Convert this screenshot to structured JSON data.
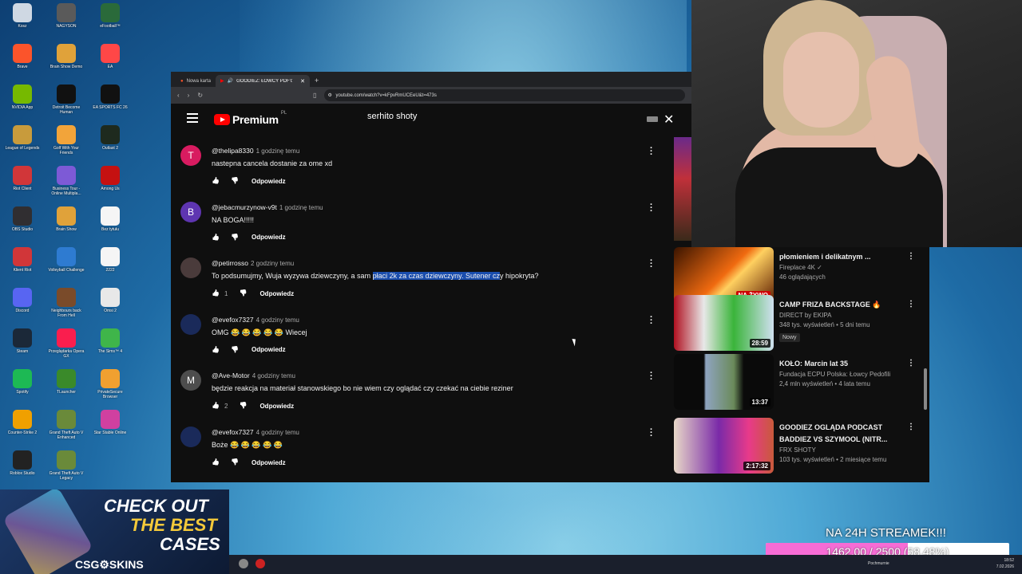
{
  "desktop_icons": [
    {
      "label": "Kosz",
      "color": "#cfd8e3"
    },
    {
      "label": "NAGYSON",
      "color": "#5a5a5a"
    },
    {
      "label": "eFootball™",
      "color": "#2a6a3a"
    },
    {
      "label": "Brave",
      "color": "#fb542b"
    },
    {
      "label": "Brain Show Demo",
      "color": "#e0a23a"
    },
    {
      "label": "EA",
      "color": "#ff4747"
    },
    {
      "label": "NVIDIA App",
      "color": "#76b900"
    },
    {
      "label": "Detroit Become Human",
      "color": "#111111"
    },
    {
      "label": "EA SPORTS FC 26",
      "color": "#111111"
    },
    {
      "label": "League of Legends",
      "color": "#c89b3c"
    },
    {
      "label": "Golf With Your Friends",
      "color": "#f2a43a"
    },
    {
      "label": "Outlast 2",
      "color": "#1e2a1e"
    },
    {
      "label": "Riot Client",
      "color": "#d13639"
    },
    {
      "label": "Business Tour - Online Multipla...",
      "color": "#7d5ad6"
    },
    {
      "label": "Among Us",
      "color": "#c51111"
    },
    {
      "label": "OBS Studio",
      "color": "#302e31"
    },
    {
      "label": "Brain Show",
      "color": "#e0a23a"
    },
    {
      "label": "Bez tytułu",
      "color": "#f5f5f5"
    },
    {
      "label": "Klient Riot",
      "color": "#d13639"
    },
    {
      "label": "Volleyball Challenge",
      "color": "#2e7bd1"
    },
    {
      "label": "2222",
      "color": "#f5f5f5"
    },
    {
      "label": "Discord",
      "color": "#5865f2"
    },
    {
      "label": "Neighbours back From Hell",
      "color": "#7a4b2a"
    },
    {
      "label": "Omsi 2",
      "color": "#e8e8e8"
    },
    {
      "label": "Steam",
      "color": "#1b2838"
    },
    {
      "label": "Przeglądarka Opera GX",
      "color": "#fa1e4e"
    },
    {
      "label": "The Sims™ 4",
      "color": "#3fb54a"
    },
    {
      "label": "Spotify",
      "color": "#1db954"
    },
    {
      "label": "TLauncher",
      "color": "#3a8a2a"
    },
    {
      "label": "PrivateSecure Browser",
      "color": "#f0a030"
    },
    {
      "label": "Counter-Strike 2",
      "color": "#f0a000"
    },
    {
      "label": "Grand Theft Auto V Enhanced",
      "color": "#6a8a3a"
    },
    {
      "label": "Star Stable Online",
      "color": "#d040a0"
    },
    {
      "label": "Roblox Studio",
      "color": "#222222"
    },
    {
      "label": "Grand Theft Auto V Legacy",
      "color": "#6a8a3a"
    }
  ],
  "browser": {
    "tabs": [
      {
        "label": "Nowa karta"
      },
      {
        "label": "GOODIEZ: ŁOWCY PDF'ów ni..."
      }
    ],
    "new_tab": "+",
    "url": "youtube.com/watch?v=kFpvRmUCEeU&t=473s"
  },
  "youtube": {
    "logo": "Premium",
    "country": "PL",
    "search_value": "serhito shoty",
    "close": "✕",
    "reply_label": "Odpowiedz",
    "comments": [
      {
        "avatar": "T",
        "avatar_color": "#d81b60",
        "author": "@thelipa8330",
        "time": "1 godzinę temu",
        "text": "nastepna cancela dostanie za ome xd",
        "likes": ""
      },
      {
        "avatar": "B",
        "avatar_color": "#5e35b1",
        "author": "@jebacmurzynow-v9t",
        "time": "1 godzinę temu",
        "text": "NA BOGA!!!!!",
        "likes": ""
      },
      {
        "avatar": "",
        "avatar_color": "#4a3b3b",
        "author": "@petirrosso",
        "time": "2 godziny temu",
        "text_pre": "To podsumujmy, Wuja wyzywa dziewczyny, a sam ",
        "text_hl": "płaci 2k za czas dziewczyny. Sutener cz",
        "text_post": "y hipokryta?",
        "likes": "1"
      },
      {
        "avatar": "",
        "avatar_color": "#1a2a5a",
        "author": "@evefox7327",
        "time": "4 godziny temu",
        "text": "OMG 😂 😂 😂 😂 😂  Wiecej",
        "likes": ""
      },
      {
        "avatar": "M",
        "avatar_color": "#4d4d4d",
        "author": "@Ave-Motor",
        "time": "4 godziny temu",
        "text": "będzie reakcja na materiał stanowskiego bo nie wiem czy oglądać czy czekać na ciebie reziner",
        "likes": "2"
      },
      {
        "avatar": "",
        "avatar_color": "#1a2a5a",
        "author": "@evefox7327",
        "time": "4 godziny temu",
        "text": "Boże 😂 😂 😂 😂 😂",
        "likes": ""
      }
    ],
    "recommendations": [
      {
        "title": "płomieniem i delikatnym ...",
        "title2": "",
        "channel": "Fireplace 4K ✓",
        "meta": "46 oglądających",
        "badge": "",
        "duration": "",
        "live": "NA ŻYWO",
        "thumb": "linear-gradient(135deg,#3a1400,#f06a10 50%,#ffd060 60%,#5a1a00)"
      },
      {
        "title": "CAMP FRIZA BACKSTAGE 🔥",
        "title2": "",
        "channel": "DIRECT by EKIPA",
        "meta": "348 tys. wyświetleń • 5 dni temu",
        "badge": "Nowy",
        "duration": "28:59",
        "live": "",
        "thumb": "linear-gradient(90deg,#b01020,#e8e8e8 30%,#3ab43a 60%,#d0e0f0)"
      },
      {
        "title": "KOŁO: Marcin lat 35",
        "title2": "",
        "channel": "Fundacja ECPU Polska: Łowcy Pedofili",
        "meta": "2,4 mln wyświetleń • 4 lata temu",
        "badge": "",
        "duration": "13:37",
        "live": "",
        "thumb": "linear-gradient(90deg,#0a0a0a 30%,#8fa4c0 32%,#6a8a5a 60%,#0a0a0a 70%)"
      },
      {
        "title": "GOODIEZ OGLĄDA PODCAST",
        "title2": "BADDIEZ VS SZYMOOL (NITR...",
        "channel": "FRX SHOTY",
        "meta": "103 tys. wyświetleń • 2 miesiące temu",
        "badge": "",
        "duration": "2:17:32",
        "live": "",
        "thumb": "linear-gradient(90deg,#e8d8c8,#7a2aa8 45%,#e83a8a 75%,#c85a3a)"
      }
    ]
  },
  "banner": {
    "line1": "CHECK OUT",
    "line2": "THE BEST",
    "line3": "CASES",
    "logo": "CSG⚙SKINS"
  },
  "goal": {
    "title": "NA 24H STREAMEK!!!",
    "text": "1462.00 / 2500 (58.48%)",
    "fraction": 0.5848
  },
  "taskbar": {
    "weather": "Pochmurnie",
    "time": "18:52",
    "date": "7.02.2026"
  }
}
